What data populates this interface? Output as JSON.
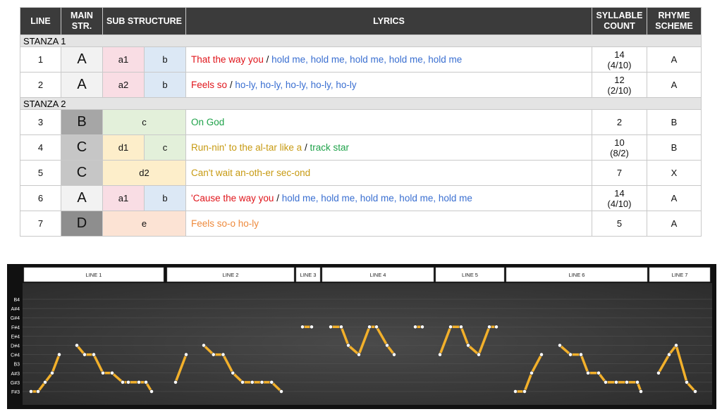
{
  "table": {
    "headers": {
      "line": "LINE",
      "main": "MAIN STR.",
      "sub": "SUB STRUCTURE",
      "lyrics": "LYRICS",
      "syllable": "SYLLABLE COUNT",
      "rhyme": "RHYME SCHEME"
    },
    "stanzas": [
      {
        "label": "STANZA 1",
        "rows": [
          {
            "line": "1",
            "main": "A",
            "sub": [
              "a1",
              "b"
            ],
            "lyrics_a": "That the way you",
            "sep": "/",
            "lyrics_b": "hold me, hold me, hold me, hold me, hold me",
            "syll": "14",
            "syll_detail": "(4/10)",
            "rhyme": "A"
          },
          {
            "line": "2",
            "main": "A",
            "sub": [
              "a2",
              "b"
            ],
            "lyrics_a": "Feels so",
            "sep": "/",
            "lyrics_b": "ho-ly, ho-ly, ho-ly, ho-ly, ho-ly",
            "syll": "12",
            "syll_detail": "(2/10)",
            "rhyme": "A"
          }
        ]
      },
      {
        "label": "STANZA 2",
        "rows": [
          {
            "line": "3",
            "main": "B",
            "sub": [
              "c"
            ],
            "lyrics_a": "On God",
            "sep": "",
            "lyrics_b": "",
            "syll": "2",
            "syll_detail": "",
            "rhyme": "B"
          },
          {
            "line": "4",
            "main": "C",
            "sub": [
              "d1",
              "c"
            ],
            "lyrics_a": "Run-nin' to the al-tar like a",
            "sep": "/",
            "lyrics_b": "track star",
            "syll": "10",
            "syll_detail": "(8/2)",
            "rhyme": "B"
          },
          {
            "line": "5",
            "main": "C",
            "sub": [
              "d2"
            ],
            "lyrics_a": "Can't wait an-oth-er sec-ond",
            "sep": "",
            "lyrics_b": "",
            "syll": "7",
            "syll_detail": "",
            "rhyme": "X"
          },
          {
            "line": "6",
            "main": "A",
            "sub": [
              "a1",
              "b"
            ],
            "lyrics_a": "'Cause the way you",
            "sep": "/",
            "lyrics_b": "hold me, hold me, hold me, hold me, hold me",
            "syll": "14",
            "syll_detail": "(4/10)",
            "rhyme": "A"
          },
          {
            "line": "7",
            "main": "D",
            "sub": [
              "e"
            ],
            "lyrics_a": "Feels so-o ho-ly",
            "sep": "",
            "lyrics_b": "",
            "syll": "5",
            "syll_detail": "",
            "rhyme": "A"
          }
        ]
      }
    ]
  },
  "colors": {
    "main_A": "#f2f2f2",
    "main_B": "#a6a6a6",
    "main_C": "#c6c6c6",
    "main_D": "#8e8e8e",
    "sub_a": "#f9dde4",
    "sub_b": "#dce8f5",
    "sub_c": "#e3f0da",
    "sub_d": "#fdeeca",
    "sub_e": "#fce3d4",
    "lyric_red": "#e0151b",
    "lyric_blue": "#3a6fd1",
    "lyric_green": "#1fa24a",
    "lyric_gold": "#c79a12",
    "lyric_orange": "#ee8a3c",
    "pitch_line": "#f2b02b",
    "pitch_point": "#ffffff",
    "pitch_bg": "#444444"
  },
  "pitch_diagram": {
    "pitch_labels": [
      "B4",
      "A#4",
      "G#4",
      "F#4",
      "E#4",
      "D#4",
      "C#4",
      "B3",
      "A#3",
      "G#3",
      "F#3"
    ],
    "line_labels": [
      "LINE 1",
      "LINE 2",
      "LINE 3",
      "LINE 4",
      "LINE 5",
      "LINE 6",
      "LINE 7"
    ],
    "segments": [
      [
        [
          "F#3",
          "F#3",
          "G#3",
          "A#3",
          "C#4"
        ],
        [
          "D#4",
          "C#4",
          "C#4",
          "A#3",
          "A#3",
          "G#3",
          "G#3",
          "G#3",
          "G#3",
          "F#3"
        ]
      ],
      [
        [
          "G#3",
          "C#4"
        ],
        [
          "D#4",
          "C#4",
          "C#4",
          "A#3",
          "G#3",
          "G#3",
          "G#3",
          "G#3",
          "F#3"
        ]
      ],
      [
        [
          "F#4",
          "F#4"
        ]
      ],
      [
        [
          "F#4",
          "F#4",
          "D#4",
          "C#4",
          "F#4",
          "F#4",
          "D#4",
          "C#4"
        ]
      ],
      [
        [
          "F#4",
          "F#4"
        ],
        [
          "C#4",
          "F#4",
          "F#4",
          "D#4",
          "C#4",
          "F#4",
          "F#4"
        ]
      ],
      [
        [
          "F#3",
          "F#3",
          "A#3",
          "C#4"
        ],
        [
          "D#4",
          "C#4",
          "C#4",
          "A#3",
          "A#3",
          "G#3",
          "G#3",
          "G#3",
          "G#3",
          "F#3"
        ]
      ],
      [
        [
          "A#3",
          "C#4",
          "D#4",
          "G#3",
          "F#3"
        ]
      ]
    ]
  }
}
